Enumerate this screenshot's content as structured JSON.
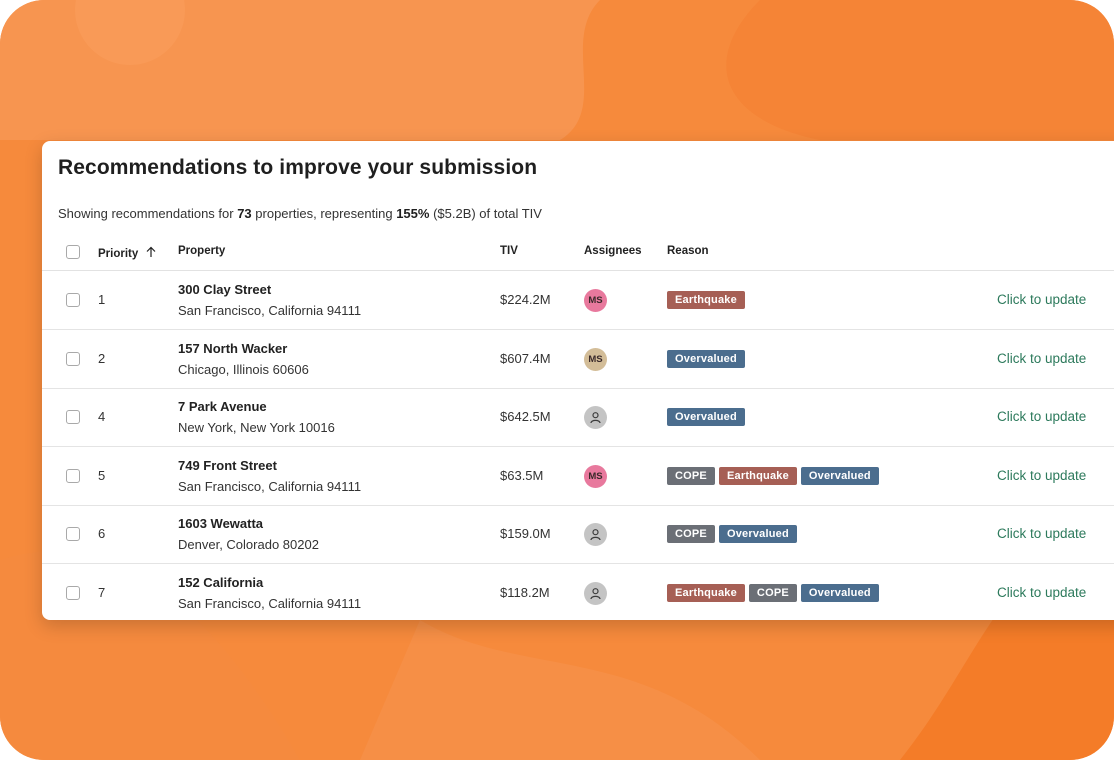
{
  "colors": {
    "background": "#f68a3c",
    "earthquake": "#a65f55",
    "cope": "#6b6f76",
    "overvalued": "#4b6d8e",
    "link": "#2d7a5c",
    "avatar_pink": "#e8799d",
    "avatar_tan": "#d3bd98",
    "avatar_gray": "#c4c4c4"
  },
  "card": {
    "title": "Recommendations to improve your submission",
    "summary": {
      "prefix": "Showing recommendations for ",
      "count": "73",
      "middle": " properties, representing ",
      "percent": "155%",
      "suffix": " ($5.2B) of total TIV"
    }
  },
  "table": {
    "headers": {
      "priority": "Priority",
      "priority_sort_icon": "arrow-up-icon",
      "property": "Property",
      "tiv": "TIV",
      "assignees": "Assignees",
      "reason": "Reason"
    },
    "rows": [
      {
        "priority": "1",
        "street": "300 Clay Street",
        "city": "San Francisco, California 94111",
        "tiv": "$224.2M",
        "assignee": {
          "type": "initials",
          "text": "MS",
          "color": "#e8799d"
        },
        "reasons": [
          "Earthquake"
        ],
        "action": "Click to update"
      },
      {
        "priority": "2",
        "street": "157 North Wacker",
        "city": "Chicago, Illinois 60606",
        "tiv": "$607.4M",
        "assignee": {
          "type": "initials",
          "text": "MS",
          "color": "#d3bd98"
        },
        "reasons": [
          "Overvalued"
        ],
        "action": "Click to update"
      },
      {
        "priority": "4",
        "street": "7 Park Avenue",
        "city": "New York, New York 10016",
        "tiv": "$642.5M",
        "assignee": {
          "type": "person-icon",
          "text": "",
          "color": "#c4c4c4"
        },
        "reasons": [
          "Overvalued"
        ],
        "action": "Click to update"
      },
      {
        "priority": "5",
        "street": "749 Front Street",
        "city": "San Francisco, California 94111",
        "tiv": "$63.5M",
        "assignee": {
          "type": "initials",
          "text": "MS",
          "color": "#e8799d"
        },
        "reasons": [
          "COPE",
          "Earthquake",
          "Overvalued"
        ],
        "action": "Click to update"
      },
      {
        "priority": "6",
        "street": "1603 Wewatta",
        "city": "Denver, Colorado 80202",
        "tiv": "$159.0M",
        "assignee": {
          "type": "person-icon",
          "text": "",
          "color": "#c4c4c4"
        },
        "reasons": [
          "COPE",
          "Overvalued"
        ],
        "action": "Click to update"
      },
      {
        "priority": "7",
        "street": "152 California",
        "city": "San Francisco, California 94111",
        "tiv": "$118.2M",
        "assignee": {
          "type": "person-icon",
          "text": "",
          "color": "#c4c4c4"
        },
        "reasons": [
          "Earthquake",
          "COPE",
          "Overvalued"
        ],
        "action": "Click to update"
      }
    ]
  }
}
